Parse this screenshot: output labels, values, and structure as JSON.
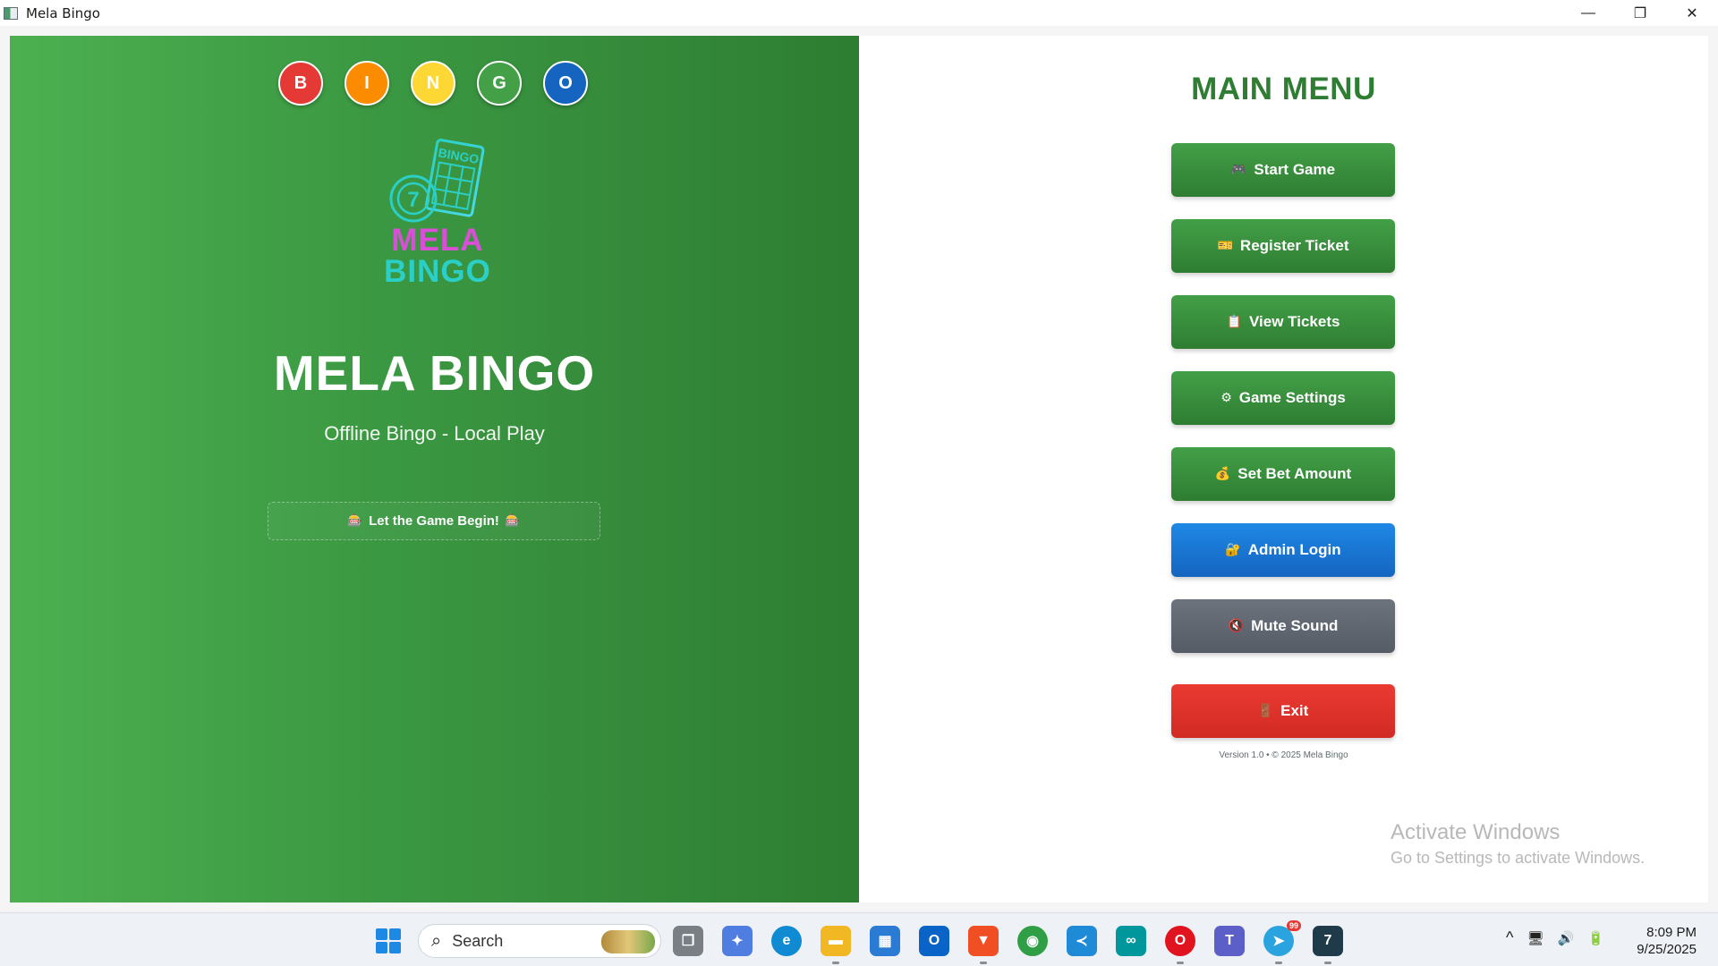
{
  "window": {
    "title": "Mela Bingo",
    "controls": {
      "minimize": "—",
      "restore": "❐",
      "close": "✕"
    }
  },
  "left": {
    "balls": [
      {
        "letter": "B",
        "color": "#e53935"
      },
      {
        "letter": "I",
        "color": "#fb8c00"
      },
      {
        "letter": "N",
        "color": "#fdd835"
      },
      {
        "letter": "G",
        "color": "#43a047"
      },
      {
        "letter": "O",
        "color": "#1565c0"
      }
    ],
    "logo": {
      "ball_number": "7",
      "card_label": "BINGO",
      "line1": "MELA",
      "line2": "BINGO"
    },
    "title": "MELA BINGO",
    "subtitle": "Offline Bingo - Local Play",
    "tagline": "Let the Game Begin!",
    "tagline_icon": "🎰"
  },
  "menu": {
    "title": "MAIN MENU",
    "buttons": [
      {
        "icon": "🎮",
        "label": "Start Game",
        "style": "green"
      },
      {
        "icon": "🎫",
        "label": "Register Ticket",
        "style": "green"
      },
      {
        "icon": "📋",
        "label": "View Tickets",
        "style": "green"
      },
      {
        "icon": "⚙",
        "label": "Game Settings",
        "style": "green"
      },
      {
        "icon": "💰",
        "label": "Set Bet Amount",
        "style": "green"
      },
      {
        "icon": "🔐",
        "label": "Admin Login",
        "style": "blue"
      },
      {
        "icon": "🔇",
        "label": "Mute Sound",
        "style": "gray"
      },
      {
        "icon": "🚪",
        "label": "Exit",
        "style": "red"
      }
    ],
    "version": "Version 1.0 • © 2025 Mela Bingo"
  },
  "watermark": {
    "line1": "Activate Windows",
    "line2": "Go to Settings to activate Windows."
  },
  "taskbar": {
    "search_placeholder": "Search",
    "apps": [
      {
        "name": "task-view",
        "color": "#7a7f86"
      },
      {
        "name": "copilot",
        "color": "#4f7de0"
      },
      {
        "name": "edge",
        "color": "#0f8ad3"
      },
      {
        "name": "file-explorer",
        "color": "#f2b824"
      },
      {
        "name": "microsoft-store",
        "color": "#2a7bd3"
      },
      {
        "name": "outlook",
        "color": "#0a64c8"
      },
      {
        "name": "brave",
        "color": "#f04e23"
      },
      {
        "name": "chrome",
        "color": "#2f9e44"
      },
      {
        "name": "vscode",
        "color": "#1f8ad6"
      },
      {
        "name": "arduino",
        "color": "#00979c"
      },
      {
        "name": "opera",
        "color": "#e0131e"
      },
      {
        "name": "teams",
        "color": "#5b5fc7"
      },
      {
        "name": "telegram",
        "color": "#2aa3df"
      },
      {
        "name": "mela-bingo",
        "color": "#1f3b4a"
      }
    ],
    "telegram_badge": "99",
    "tray": {
      "chevron": "^",
      "network": "🖥",
      "volume": "🔊",
      "battery": "🔋"
    },
    "time": "8:09 PM",
    "date": "9/25/2025"
  }
}
